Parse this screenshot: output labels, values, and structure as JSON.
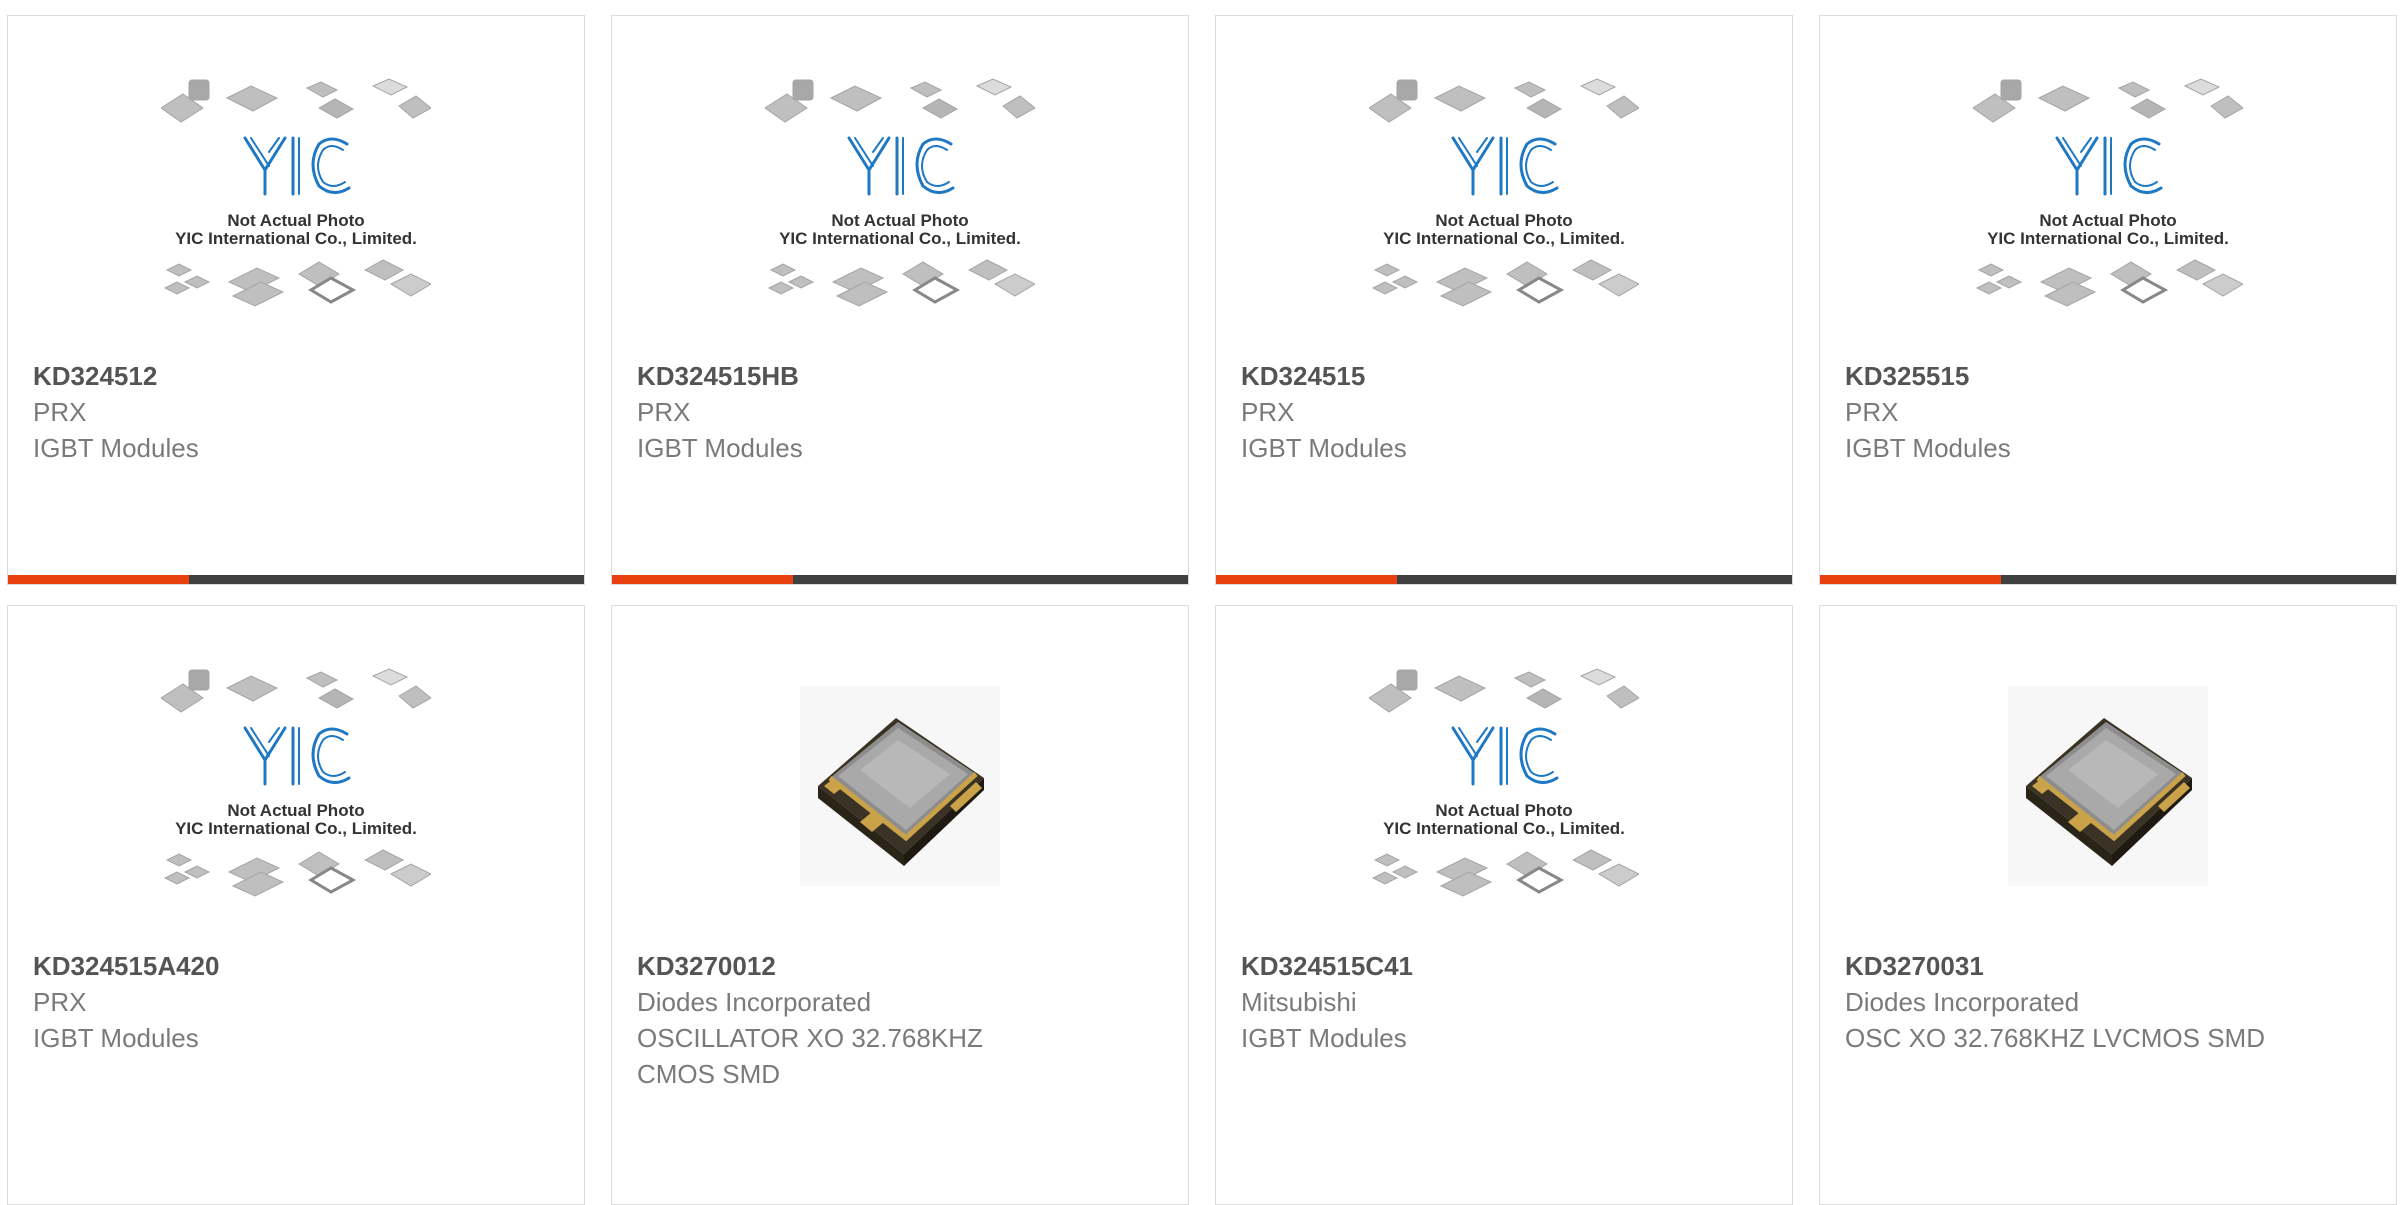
{
  "placeholder_image": {
    "line1": "Not Actual Photo",
    "line2": "YIC International Co., Limited.",
    "logo_text": "YIC",
    "logo_color": "#1f78c4"
  },
  "colors": {
    "accent": "#e8400e",
    "bar": "#3f3f3f",
    "border": "#dcdcdc",
    "pn_text": "#545454",
    "meta_text": "#7a7a7a"
  },
  "products": [
    {
      "part_number": "KD324512",
      "manufacturer": "PRX",
      "category": "IGBT Modules",
      "image": "placeholder-icon"
    },
    {
      "part_number": "KD324515HB",
      "manufacturer": "PRX",
      "category": "IGBT Modules",
      "image": "placeholder-icon"
    },
    {
      "part_number": "KD324515",
      "manufacturer": "PRX",
      "category": "IGBT Modules",
      "image": "placeholder-icon"
    },
    {
      "part_number": "KD325515",
      "manufacturer": "PRX",
      "category": "IGBT Modules",
      "image": "placeholder-icon"
    },
    {
      "part_number": "KD324515A420",
      "manufacturer": "PRX",
      "category": "IGBT Modules",
      "image": "placeholder-icon"
    },
    {
      "part_number": "KD3270012",
      "manufacturer": "Diodes Incorporated",
      "category": "OSCILLATOR XO 32.768KHZ CMOS SMD",
      "image": "crystal-oscillator-icon"
    },
    {
      "part_number": "KD324515C41",
      "manufacturer": "Mitsubishi",
      "category": "IGBT Modules",
      "image": "placeholder-icon"
    },
    {
      "part_number": "KD3270031",
      "manufacturer": "Diodes Incorporated",
      "category": "OSC XO 32.768KHZ LVCMOS SMD",
      "image": "crystal-oscillator-icon"
    }
  ]
}
